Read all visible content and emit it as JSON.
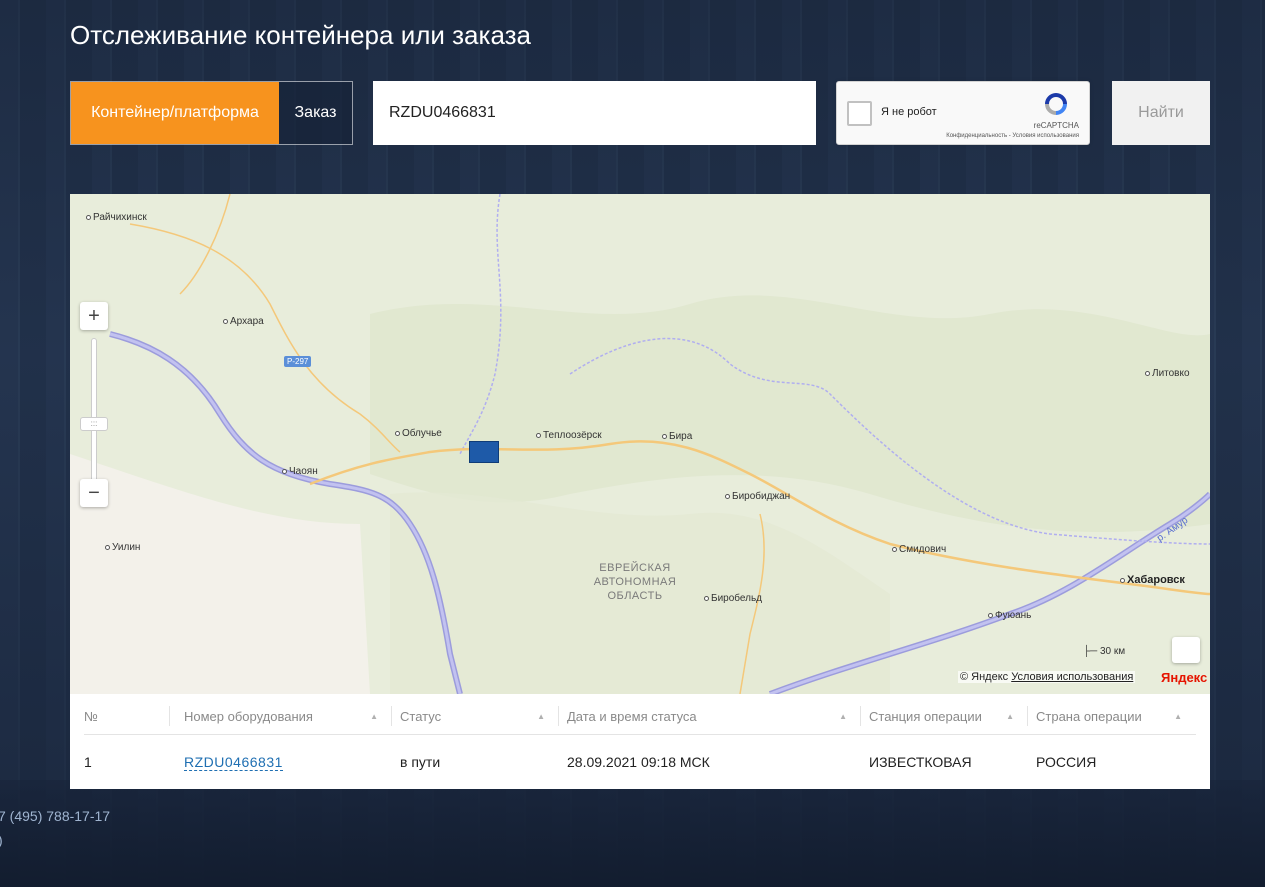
{
  "header": {
    "title": "Отслеживание контейнера или заказа"
  },
  "tabs": [
    {
      "label": "Контейнер/платформа",
      "active": true
    },
    {
      "label": "Заказ",
      "active": false
    }
  ],
  "search": {
    "value": "RZDU0466831"
  },
  "captcha": {
    "label": "Я не робот",
    "brand": "reCAPTCHA",
    "terms": "Конфиденциальность - Условия использования"
  },
  "find_button": {
    "label": "Найти"
  },
  "map": {
    "cities": [
      {
        "name": "Райчихинск"
      },
      {
        "name": "Архара"
      },
      {
        "name": "Облучье"
      },
      {
        "name": "Теплоозёрск"
      },
      {
        "name": "Бира"
      },
      {
        "name": "Чаоян"
      },
      {
        "name": "Биробиджан"
      },
      {
        "name": "Литовко"
      },
      {
        "name": "Смидович"
      },
      {
        "name": "Уилин"
      },
      {
        "name": "Хабаровск"
      },
      {
        "name": "Биробельд"
      },
      {
        "name": "Фуюань"
      }
    ],
    "region_label": "ЕВРЕЙСКАЯ АВТОНОМНАЯ ОБЛАСТЬ",
    "road_badge": "Р-297",
    "river_label": "р. Амур",
    "scale": "30 км",
    "copyright": "© Яндекс",
    "terms_link": "Условия использования",
    "logo": "Яндекс",
    "zoom_in": "+",
    "zoom_out": "−",
    "accent_marker": "#1e5aa8"
  },
  "table": {
    "columns": [
      "№",
      "Номер оборудования",
      "Статус",
      "Дата и время статуса",
      "Станция операции",
      "Страна операции"
    ],
    "rows": [
      {
        "num": "1",
        "equipment": "RZDU0466831",
        "status": "в пути",
        "datetime": "28.09.2021 09:18 МСК",
        "station": "ИЗВЕСТКОВАЯ",
        "country": "РОССИЯ"
      }
    ]
  },
  "footer": {
    "phone": "7 (495) 788-17-17",
    "extra": ")"
  },
  "colors": {
    "accent": "#f7931e",
    "link": "#1f6fb2",
    "background": "#1f2e45"
  }
}
